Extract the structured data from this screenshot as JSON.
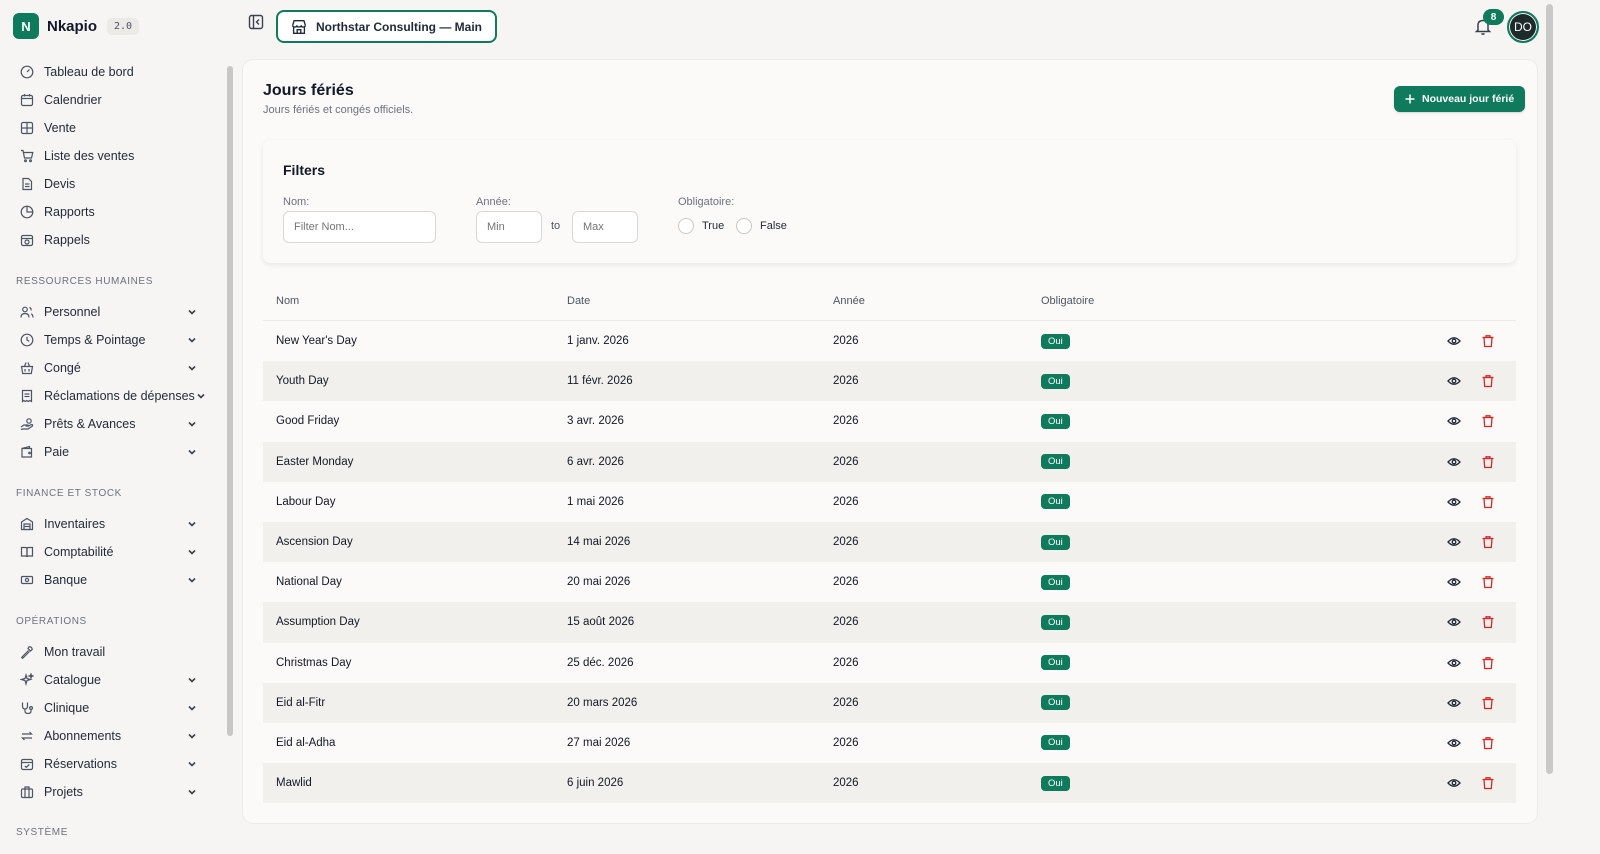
{
  "brand": {
    "logo_letter": "N",
    "name": "Nkapio",
    "version": "2.0"
  },
  "nav_top": [
    {
      "label": "Tableau de bord",
      "icon": "gauge-icon",
      "name": "sidebar-item-tableau-de-bord"
    },
    {
      "label": "Calendrier",
      "icon": "calendar-icon",
      "name": "sidebar-item-calendrier"
    },
    {
      "label": "Vente",
      "icon": "grid-icon",
      "name": "sidebar-item-vente"
    },
    {
      "label": "Liste des ventes",
      "icon": "cart-icon",
      "name": "sidebar-item-liste-des-ventes"
    },
    {
      "label": "Devis",
      "icon": "document-icon",
      "name": "sidebar-item-devis"
    },
    {
      "label": "Rapports",
      "icon": "pie-chart-icon",
      "name": "sidebar-item-rapports"
    },
    {
      "label": "Rappels",
      "icon": "calendar-clock-icon",
      "name": "sidebar-item-rappels"
    }
  ],
  "sections": {
    "rh": "RESSOURCES HUMAINES",
    "finance": "FINANCE ET STOCK",
    "ops": "OPÉRATIONS",
    "system": "SYSTÈME"
  },
  "nav_rh": [
    {
      "label": "Personnel",
      "icon": "users-icon",
      "name": "sidebar-item-personnel"
    },
    {
      "label": "Temps & Pointage",
      "icon": "clock-icon",
      "name": "sidebar-item-temps-pointage"
    },
    {
      "label": "Congé",
      "icon": "basket-icon",
      "name": "sidebar-item-conge"
    },
    {
      "label": "Réclamations de dépenses",
      "icon": "receipt-icon",
      "name": "sidebar-item-reclamations"
    },
    {
      "label": "Prêts & Avances",
      "icon": "hand-coins-icon",
      "name": "sidebar-item-prets-avances"
    },
    {
      "label": "Paie",
      "icon": "wallet-icon",
      "name": "sidebar-item-paie"
    }
  ],
  "nav_finance": [
    {
      "label": "Inventaires",
      "icon": "warehouse-icon",
      "name": "sidebar-item-inventaires"
    },
    {
      "label": "Comptabilité",
      "icon": "book-icon",
      "name": "sidebar-item-comptabilite"
    },
    {
      "label": "Banque",
      "icon": "banknote-icon",
      "name": "sidebar-item-banque"
    }
  ],
  "nav_ops": [
    {
      "label": "Mon travail",
      "icon": "wrench-icon",
      "name": "sidebar-item-mon-travail",
      "chevron": false
    },
    {
      "label": "Catalogue",
      "icon": "sparkles-icon",
      "name": "sidebar-item-catalogue",
      "chevron": true
    },
    {
      "label": "Clinique",
      "icon": "stethoscope-icon",
      "name": "sidebar-item-clinique",
      "chevron": true
    },
    {
      "label": "Abonnements",
      "icon": "repeat-icon",
      "name": "sidebar-item-abonnements",
      "chevron": true
    },
    {
      "label": "Réservations",
      "icon": "calendar-check-icon",
      "name": "sidebar-item-reservations",
      "chevron": true
    },
    {
      "label": "Projets",
      "icon": "briefcase-icon",
      "name": "sidebar-item-projets",
      "chevron": true
    }
  ],
  "header": {
    "org_name": "Northstar Consulting — Main",
    "notif_count": "8",
    "avatar_initials": "DO"
  },
  "page": {
    "title": "Jours fériés",
    "subtitle": "Jours fériés et congés officiels.",
    "new_button": "Nouveau jour férié"
  },
  "filters": {
    "title": "Filters",
    "nom_label": "Nom:",
    "nom_placeholder": "Filter Nom...",
    "annee_label": "Année:",
    "min_placeholder": "Min",
    "max_placeholder": "Max",
    "to_label": "to",
    "obl_label": "Obligatoire:",
    "true_label": "True",
    "false_label": "False"
  },
  "table": {
    "headers": {
      "nom": "Nom",
      "date": "Date",
      "annee": "Année",
      "obligatoire": "Obligatoire"
    },
    "rows": [
      {
        "nom": "New Year's Day",
        "date": "1 janv. 2026",
        "annee": "2026",
        "obligatoire": "Oui"
      },
      {
        "nom": "Youth Day",
        "date": "11 févr. 2026",
        "annee": "2026",
        "obligatoire": "Oui"
      },
      {
        "nom": "Good Friday",
        "date": "3 avr. 2026",
        "annee": "2026",
        "obligatoire": "Oui"
      },
      {
        "nom": "Easter Monday",
        "date": "6 avr. 2026",
        "annee": "2026",
        "obligatoire": "Oui"
      },
      {
        "nom": "Labour Day",
        "date": "1 mai 2026",
        "annee": "2026",
        "obligatoire": "Oui"
      },
      {
        "nom": "Ascension Day",
        "date": "14 mai 2026",
        "annee": "2026",
        "obligatoire": "Oui"
      },
      {
        "nom": "National Day",
        "date": "20 mai 2026",
        "annee": "2026",
        "obligatoire": "Oui"
      },
      {
        "nom": "Assumption Day",
        "date": "15 août 2026",
        "annee": "2026",
        "obligatoire": "Oui"
      },
      {
        "nom": "Christmas Day",
        "date": "25 déc. 2026",
        "annee": "2026",
        "obligatoire": "Oui"
      },
      {
        "nom": "Eid al-Fitr",
        "date": "20 mars 2026",
        "annee": "2026",
        "obligatoire": "Oui"
      },
      {
        "nom": "Eid al-Adha",
        "date": "27 mai 2026",
        "annee": "2026",
        "obligatoire": "Oui"
      },
      {
        "nom": "Mawlid",
        "date": "6 juin 2026",
        "annee": "2026",
        "obligatoire": "Oui"
      }
    ]
  },
  "colors": {
    "accent": "#0f7a5c",
    "delete": "#dc2626",
    "background": "#f6f5f3"
  }
}
